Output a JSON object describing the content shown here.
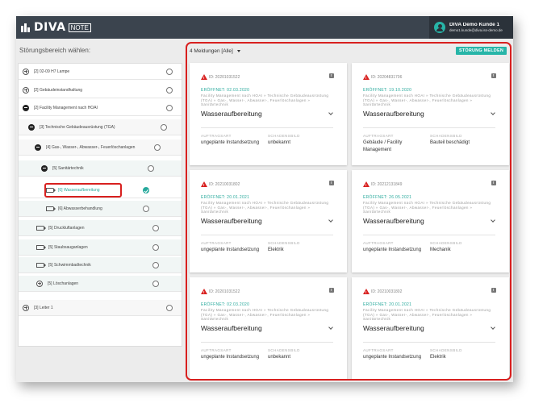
{
  "header": {
    "logo_text": "DIVA",
    "logo_badge": "NOTE",
    "user_name": "DIVA Demo Kunde 1",
    "user_email": "demo1.kunde@diva.iss-demo.de"
  },
  "sidebar": {
    "title": "Störungsbereich wählen:",
    "items": [
      {
        "label": "[2] 02-09 H7 Lampe",
        "icon": "plus-circle-icon"
      },
      {
        "label": "[2] Gebäudeinstandhaltung",
        "icon": "plus-circle-icon"
      },
      {
        "label": "[2] Facility Management nach HOAI",
        "icon": "minus-circle-icon"
      },
      {
        "label": "[3] Technische Gebäudeausrüstung (TGA)",
        "icon": "minus-circle-icon"
      },
      {
        "label": "[4] Gas-, Wasser-, Abwasser-, Feuerlöschanlagen",
        "icon": "minus-circle-icon"
      },
      {
        "label": "[5] Sanitärtechnik",
        "icon": "minus-circle-icon"
      },
      {
        "label": "[6] Wasseraufbereitung",
        "icon": "tag-icon",
        "selected": true
      },
      {
        "label": "[6] Abwasserbehandlung",
        "icon": "tag-icon"
      },
      {
        "label": "[5] Druckluftanlagen",
        "icon": "tag-icon"
      },
      {
        "label": "[5] Staubsauganlagen",
        "icon": "tag-icon"
      },
      {
        "label": "[5] Schwimmbadtechnik",
        "icon": "tag-icon"
      },
      {
        "label": "[5] Löschanlagen",
        "icon": "plus-circle-icon"
      },
      {
        "label": "[3] Leiter 1",
        "icon": "plus-circle-icon"
      }
    ]
  },
  "main": {
    "filter_label": "4 Meldungen [Alle]",
    "report_button": "STÖRUNG MELDEN",
    "cards": [
      {
        "id": "ID: 20201031522",
        "opened": "ERÖFFNET: 02.03.2020",
        "path": "Facility Management nach HOAI » Technische Gebäudeausrüstung (TGA) » Gas-, Wasser-, Abwasser-, Feuerlöschanlagen » Sanitärtechnik",
        "title": "Wasseraufbereitung",
        "label1": "AUFTRAGSART",
        "value1": "ungeplante Instandsetzung",
        "label2": "SCHADENSBILD",
        "value2": "unbekannt"
      },
      {
        "id": "ID: 20204831706",
        "opened": "ERÖFFNET: 19.10.2020",
        "path": "Facility Management nach HOAI » Technische Gebäudeausrüstung (TGA) » Gas-, Wasser-, Abwasser-, Feuerlöschanlagen » Sanitärtechnik",
        "title": "Wasseraufbereitung",
        "label1": "AUFTRAGSART",
        "value1": "Gebäude / Facility Management",
        "label2": "SCHADENSBILD",
        "value2": "Bauteil beschädigt"
      },
      {
        "id": "ID: 20210031802",
        "opened": "ERÖFFNET: 20.01.2021",
        "path": "Facility Management nach HOAI » Technische Gebäudeausrüstung (TGA) » Gas-, Wasser-, Abwasser-, Feuerlöschanlagen » Sanitärtechnik",
        "title": "Wasseraufbereitung",
        "label1": "AUFTRAGSART",
        "value1": "ungeplante Instandsetzung",
        "label2": "SCHADENSBILD",
        "value2": "Elektrik"
      },
      {
        "id": "ID: 20212131849",
        "opened": "ERÖFFNET: 26.05.2021",
        "path": "Facility Management nach HOAI » Technische Gebäudeausrüstung (TGA) » Gas-, Wasser-, Abwasser-, Feuerlöschanlagen » Sanitärtechnik",
        "title": "Wasseraufbereitung",
        "label1": "AUFTRAGSART",
        "value1": "ungeplante Instandsetzung",
        "label2": "SCHADENSBILD",
        "value2": "Mechanik"
      },
      {
        "id": "ID: 20201031522",
        "opened": "ERÖFFNET: 02.03.2020",
        "path": "Facility Management nach HOAI » Technische Gebäudeausrüstung (TGA) » Gas-, Wasser-, Abwasser-, Feuerlöschanlagen » Sanitärtechnik",
        "title": "Wasseraufbereitung",
        "label1": "AUFTRAGSART",
        "value1": "ungeplante Instandsetzung",
        "label2": "SCHADENSBILD",
        "value2": "unbekannt"
      },
      {
        "id": "ID: 20210031802",
        "opened": "ERÖFFNET: 20.01.2021",
        "path": "Facility Management nach HOAI » Technische Gebäudeausrüstung (TGA) » Gas-, Wasser-, Abwasser-, Feuerlöschanlagen » Sanitärtechnik",
        "title": "Wasseraufbereitung",
        "label1": "AUFTRAGSART",
        "value1": "ungeplante Instandsetzung",
        "label2": "SCHADENSBILD",
        "value2": "Elektrik"
      }
    ]
  },
  "colors": {
    "header_bg": "#3b444e",
    "accent": "#27b5a8",
    "highlight": "#d8201f"
  }
}
